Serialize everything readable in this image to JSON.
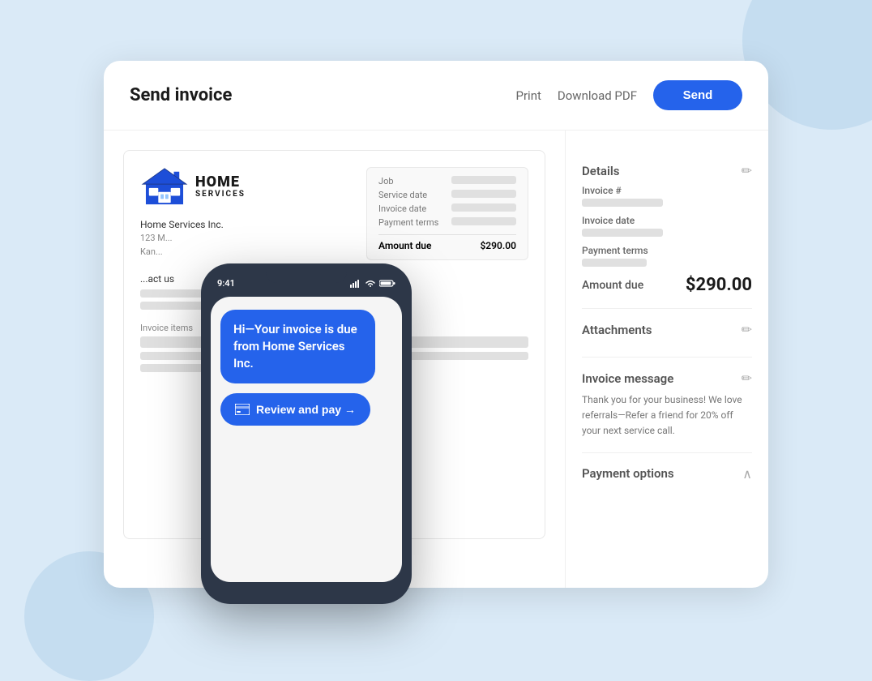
{
  "page": {
    "background": "#daeaf7"
  },
  "header": {
    "title": "Send invoice",
    "print_label": "Print",
    "download_label": "Download PDF",
    "send_label": "Send"
  },
  "invoice": {
    "company_name": "Home Services Inc.",
    "address_line1": "123 M...",
    "address_line2": "Kan...",
    "logo_home": "HOME",
    "logo_services": "SERVICES",
    "fields": {
      "job_label": "Job",
      "service_date_label": "Service date",
      "invoice_date_label": "Invoice date",
      "payment_terms_label": "Payment terms",
      "amount_due_label": "Amount due",
      "amount_due_value": "$290.00"
    },
    "contact_label": "...act us"
  },
  "phone": {
    "time": "9:41",
    "message": "Hi—Your invoice is due from Home Services Inc.",
    "review_pay_label": "Review and pay →"
  },
  "right_panel": {
    "details_title": "Details",
    "invoice_number_label": "Invoice #",
    "invoice_date_label": "Invoice date",
    "payment_terms_label": "Payment terms",
    "amount_due_label": "Amount due",
    "amount_due_value": "$290.00",
    "attachments_title": "Attachments",
    "invoice_message_title": "Invoice message",
    "invoice_message_text": "Thank you for your business! We love referrals—Refer a friend for 20% off your next service call.",
    "payment_options_title": "Payment options"
  }
}
